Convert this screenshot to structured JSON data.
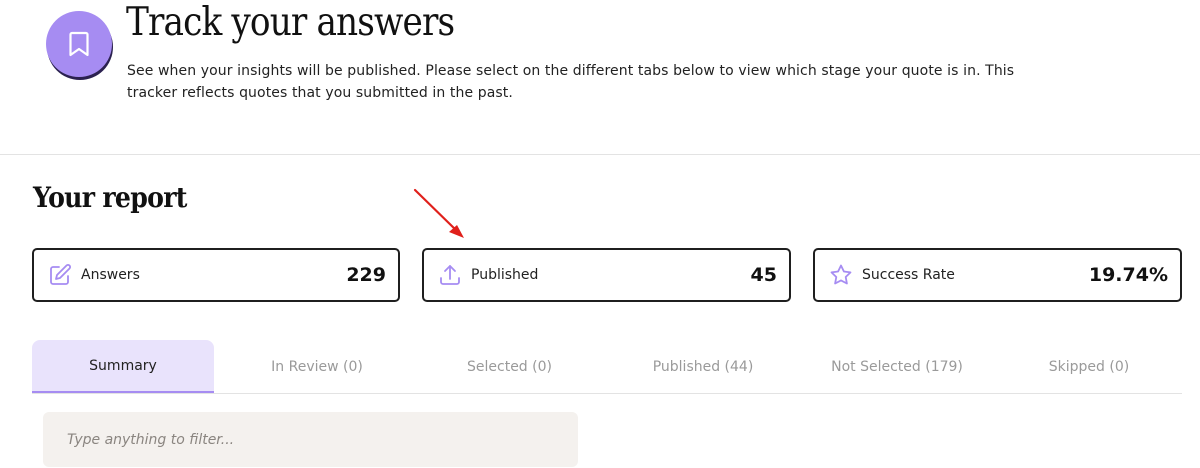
{
  "header": {
    "title": "Track your answers",
    "description": "See when your insights will be published. Please select on the different tabs below to view which stage your quote is in. This tracker reflects quotes that you submitted in the past.",
    "badge_icon": "bookmark-icon"
  },
  "report": {
    "title": "Your report",
    "stats": [
      {
        "icon": "edit-icon",
        "label": "Answers",
        "value": "229"
      },
      {
        "icon": "upload-icon",
        "label": "Published",
        "value": "45"
      },
      {
        "icon": "star-icon",
        "label": "Success Rate",
        "value": "19.74%"
      }
    ]
  },
  "tabs": [
    {
      "label": "Summary",
      "active": true
    },
    {
      "label": "In Review (0)",
      "active": false
    },
    {
      "label": "Selected (0)",
      "active": false
    },
    {
      "label": "Published (44)",
      "active": false
    },
    {
      "label": "Not Selected (179)",
      "active": false
    },
    {
      "label": "Skipped (0)",
      "active": false
    }
  ],
  "filter": {
    "placeholder": "Type anything to filter...",
    "value": ""
  },
  "annotation": {
    "type": "red-arrow",
    "target": "Published stat card",
    "color": "#e0201b"
  },
  "colors": {
    "accent": "#a68cf2",
    "accent_light": "#e9e3fc",
    "text_dark": "#111111",
    "text_muted": "#9a9a9a",
    "filter_bg": "#f4f1ee"
  }
}
